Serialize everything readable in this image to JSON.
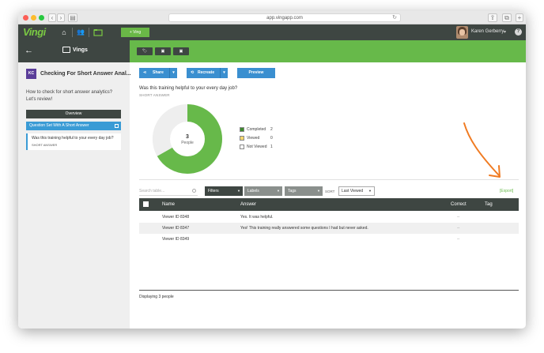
{
  "browser": {
    "url": "app.vingapp.com",
    "back_glyph": "‹",
    "forward_glyph": "›",
    "sidebar_glyph": "▤",
    "reload_glyph": "↻",
    "share_glyph": "⇪",
    "tabs_glyph": "⧉",
    "newtab_glyph": "+"
  },
  "topbar": {
    "logo": "Vingi",
    "home_glyph": "⌂",
    "people_glyph": "👥",
    "plus_ving_label": "+ Ving",
    "user_name": "Karen Gerberry",
    "user_caret": "▾",
    "help_glyph": "?"
  },
  "sidebar": {
    "back_glyph": "←",
    "title": "Vings",
    "ving_initials": "KC",
    "ving_name": "Checking For Short Answer Anal...",
    "ving_description": "How to check for short answer analytics? Let's review!",
    "overview_label": "Overview",
    "question_set_label": "Question Set With A Short Answer",
    "question_item": {
      "text": "Was this training helpful to your every day job?",
      "type": "SHORT ANSWER"
    }
  },
  "toolbar": {
    "tag_glyph": "🏷",
    "copy_glyph": "▣",
    "delete_glyph": "▣"
  },
  "actions": {
    "share_label": "Share",
    "share_icon": "⋖",
    "recreate_label": "Recreate",
    "recreate_icon": "⟲",
    "preview_label": "Preview",
    "caret": "▾"
  },
  "question": {
    "title": "Was this training helpful to your every day job?",
    "type": "SHORT ANSWER"
  },
  "chart_data": {
    "type": "pie",
    "total": "3",
    "total_label": "People",
    "categories": [
      "Completed",
      "Viewed",
      "Not Viewed"
    ],
    "values": [
      2,
      0,
      1
    ],
    "colors": [
      "#67b94a",
      "#f5d76e",
      "#eeeeee"
    ],
    "legend_position": "right"
  },
  "legend_colors": {
    "completed": "#3d8a2e",
    "viewed": "#f5d76e",
    "not_viewed": "#ffffff"
  },
  "filters": {
    "search_placeholder": "Search table...",
    "filters_label": "Filters",
    "labels_label": "Labels",
    "tags_label": "Tags",
    "sort_label": "SORT",
    "sort_value": "Last Viewed",
    "caret": "▼",
    "export_label": "[Export]"
  },
  "table": {
    "headers": [
      "Name",
      "Answer",
      "Correct",
      "Tag"
    ],
    "rows": [
      {
        "name": "Viewer ID 8348",
        "answer": "Yes. It was helpful.",
        "correct": "--"
      },
      {
        "name": "Viewer ID 8347",
        "answer": "Yes! This training really answered some questions I had but never asked.",
        "correct": "--"
      },
      {
        "name": "Viewer ID 8349",
        "answer": "",
        "correct": "--"
      }
    ]
  },
  "footer": {
    "displaying": "Displaying 3 people"
  }
}
